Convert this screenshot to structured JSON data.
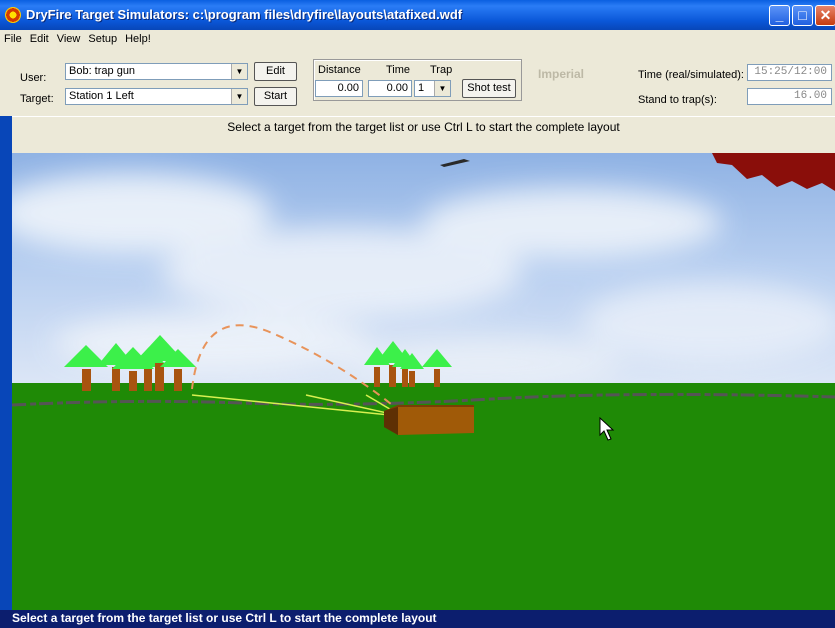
{
  "window": {
    "title": "DryFire Target Simulators: c:\\program files\\dryfire\\layouts\\atafixed.wdf",
    "controls": {
      "minimize": "_",
      "maximize": "□",
      "close": "✕"
    }
  },
  "menu": [
    "File",
    "Edit",
    "View",
    "Setup",
    "Help!"
  ],
  "toolbar": {
    "user_label": "User:",
    "user_value": "Bob: trap gun",
    "target_label": "Target:",
    "target_value": "Station 1 Left",
    "edit_button": "Edit",
    "start_button": "Start",
    "distance_label": "Distance",
    "time_label": "Time",
    "trap_label": "Trap",
    "distance_value": "0.00",
    "time_value": "0.00",
    "trap_value": "1",
    "shot_test_button": "Shot test",
    "units": "Imperial",
    "time_rs_label": "Time (real/simulated):",
    "time_rs_value": "15:25/12:00",
    "stand_label": "Stand to trap(s):",
    "stand_value": "16.00"
  },
  "message": "Select a target from the target list or use Ctrl L to start the complete layout",
  "status": "Select a target from the target list or use Ctrl L to start the complete layout",
  "colors": {
    "sky": "#a8c4ec",
    "grass": "#1f8a06",
    "trap_house": "#a05a08",
    "tree_leaves": "#3cf04a",
    "trunk": "#a85410"
  }
}
